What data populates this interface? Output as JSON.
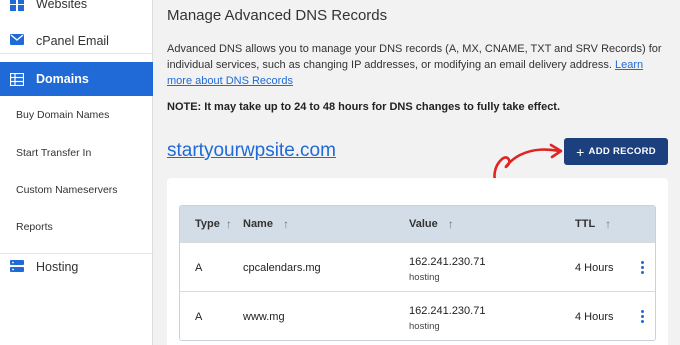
{
  "sidebar": {
    "websites_label": "Websites",
    "email_label": "cPanel Email",
    "domains_label": "Domains",
    "sub_items": [
      "Buy Domain Names",
      "Start Transfer In",
      "Custom Nameservers",
      "Reports"
    ],
    "hosting_label": "Hosting"
  },
  "main": {
    "title": "Manage Advanced DNS Records",
    "intro_text": "Advanced DNS allows you to manage your DNS records (A, MX, CNAME, TXT and SRV Records) for individual services, such as changing IP addresses, or modifying an email delivery address. ",
    "learn_more": "Learn more about DNS Records",
    "note": "NOTE: It may take up to 24 to 48 hours for DNS changes to fully take effect.",
    "domain": "startyourwpsite.com",
    "add_record_label": "ADD RECORD"
  },
  "table": {
    "columns": [
      "Type",
      "Name",
      "Value",
      "TTL"
    ],
    "sort_glyph": "↑",
    "rows": [
      {
        "type": "A",
        "name": "cpcalendars.mg",
        "value": "162.241.230.71",
        "value_sub": "hosting",
        "ttl": "4 Hours"
      },
      {
        "type": "A",
        "name": "www.mg",
        "value": "162.241.230.71",
        "value_sub": "hosting",
        "ttl": "4 Hours"
      }
    ]
  },
  "colors": {
    "accent": "#1f6ad6",
    "button": "#1c3f7d",
    "annotation_arrow": "#e02424"
  }
}
